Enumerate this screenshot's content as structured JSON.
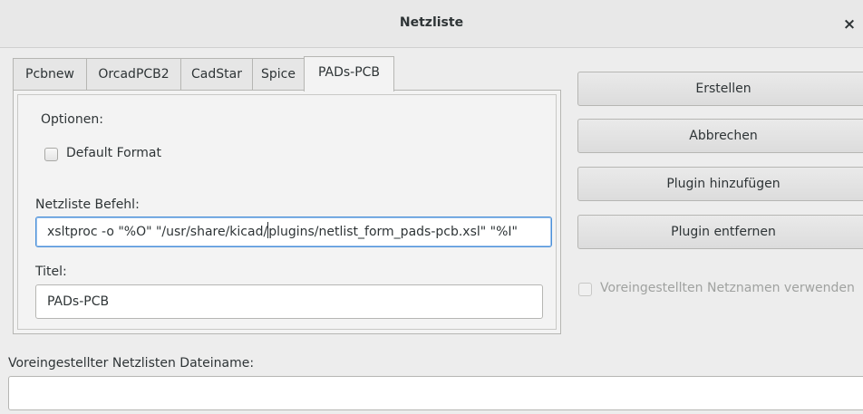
{
  "window": {
    "title": "Netzliste",
    "close_glyph": "×"
  },
  "tabs": [
    {
      "label": "Pcbnew"
    },
    {
      "label": "OrcadPCB2"
    },
    {
      "label": "CadStar"
    },
    {
      "label": "Spice"
    },
    {
      "label": "PADs-PCB",
      "active": true
    }
  ],
  "panel": {
    "options_label": "Optionen:",
    "default_format_label": "Default Format",
    "default_format_checked": false,
    "command_label": "Netzliste Befehl:",
    "command_value_before_cursor": "xsltproc -o \"%O\" \"/usr/share/kicad/",
    "command_value_after_cursor": "plugins/netlist_form_pads-pcb.xsl\" \"%I\"",
    "title_label": "Titel:",
    "title_value": "PADs-PCB"
  },
  "buttons": {
    "create": "Erstellen",
    "cancel": "Abbrechen",
    "add_plugin": "Plugin hinzufügen",
    "remove_plugin": "Plugin entfernen"
  },
  "use_default_netnames": {
    "label": "Voreingestellten Netznamen verwenden",
    "checked": false,
    "enabled": false
  },
  "filename": {
    "label": "Voreingestellter Netzlisten Dateiname:",
    "value": ""
  }
}
